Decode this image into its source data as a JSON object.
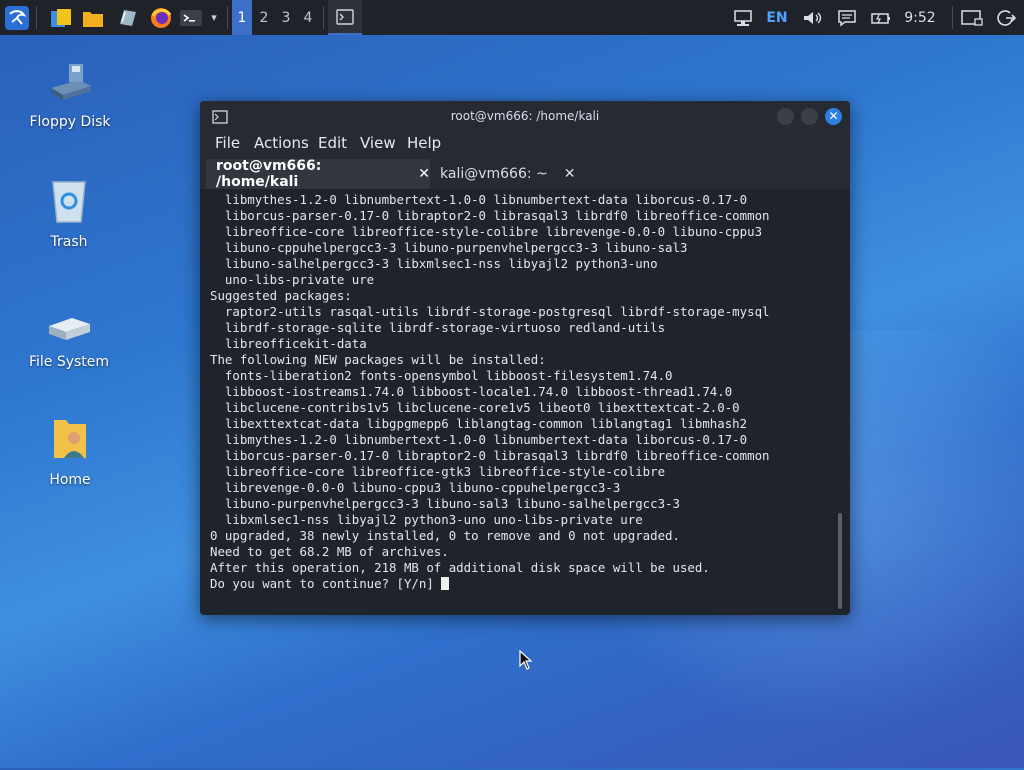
{
  "panel": {
    "workspaces": [
      "1",
      "2",
      "3",
      "4"
    ],
    "language": "EN",
    "clock": "9:52"
  },
  "desktop_icons": [
    {
      "label": "Floppy Disk"
    },
    {
      "label": "Trash"
    },
    {
      "label": "File System"
    },
    {
      "label": "Home"
    }
  ],
  "terminal": {
    "title": "root@vm666: /home/kali",
    "menu": [
      "File",
      "Actions",
      "Edit",
      "View",
      "Help"
    ],
    "tabs": [
      {
        "label": "root@vm666: /home/kali",
        "close": "✕"
      },
      {
        "label": "kali@vm666: ~",
        "close": "✕"
      }
    ],
    "lines": [
      "  libmythes-1.2-0 libnumbertext-1.0-0 libnumbertext-data liborcus-0.17-0",
      "  liborcus-parser-0.17-0 libraptor2-0 librasqal3 librdf0 libreoffice-common",
      "  libreoffice-core libreoffice-style-colibre librevenge-0.0-0 libuno-cppu3",
      "  libuno-cppuhelpergcc3-3 libuno-purpenvhelpergcc3-3 libuno-sal3",
      "  libuno-salhelpergcc3-3 libxmlsec1-nss libyajl2 python3-uno",
      "  uno-libs-private ure",
      "Suggested packages:",
      "  raptor2-utils rasqal-utils librdf-storage-postgresql librdf-storage-mysql",
      "  librdf-storage-sqlite librdf-storage-virtuoso redland-utils",
      "  libreofficekit-data",
      "The following NEW packages will be installed:",
      "  fonts-liberation2 fonts-opensymbol libboost-filesystem1.74.0",
      "  libboost-iostreams1.74.0 libboost-locale1.74.0 libboost-thread1.74.0",
      "  libclucene-contribs1v5 libclucene-core1v5 libeot0 libexttextcat-2.0-0",
      "  libexttextcat-data libgpgmepp6 liblangtag-common liblangtag1 libmhash2",
      "  libmythes-1.2-0 libnumbertext-1.0-0 libnumbertext-data liborcus-0.17-0",
      "  liborcus-parser-0.17-0 libraptor2-0 librasqal3 librdf0 libreoffice-common",
      "  libreoffice-core libreoffice-gtk3 libreoffice-style-colibre",
      "  librevenge-0.0-0 libuno-cppu3 libuno-cppuhelpergcc3-3",
      "  libuno-purpenvhelpergcc3-3 libuno-sal3 libuno-salhelpergcc3-3",
      "  libxmlsec1-nss libyajl2 python3-uno uno-libs-private ure",
      "0 upgraded, 38 newly installed, 0 to remove and 0 not upgraded.",
      "Need to get 68.2 MB of archives.",
      "After this operation, 218 MB of additional disk space will be used."
    ],
    "prompt": "Do you want to continue? [Y/n] "
  }
}
